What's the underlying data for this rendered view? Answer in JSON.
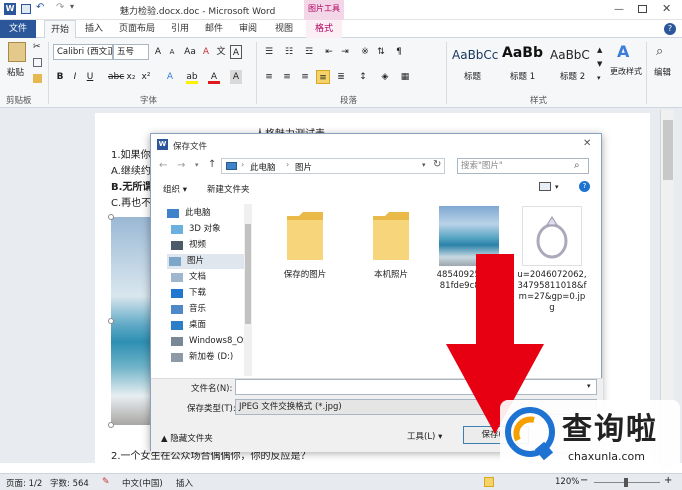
{
  "window": {
    "title": "魅力检验.docx.doc - Microsoft Word",
    "context_tab_group": "图片工具"
  },
  "ribbon_tabs": [
    "文件",
    "开始",
    "插入",
    "页面布局",
    "引用",
    "邮件",
    "审阅",
    "视图",
    "格式"
  ],
  "ribbon": {
    "font_name": "Calibri (西文正",
    "font_size": "五号",
    "paste_label": "粘贴",
    "groups": {
      "clipboard": "剪贴板",
      "font": "字体",
      "paragraph": "段落",
      "styles": "样式"
    },
    "styles": [
      {
        "sample": "AaBbCc",
        "name": "标题"
      },
      {
        "sample": "AaBb",
        "name": "标题 1"
      },
      {
        "sample": "AaBbC",
        "name": "标题 2"
      }
    ],
    "change_styles": "更改样式",
    "edit_label": "编辑"
  },
  "document": {
    "heading": "人格魅力测试表",
    "lines": [
      "1.如果你",
      "A.继续约",
      "B.无所谓",
      "C.再也不"
    ],
    "bottom_line": "2.一个女生在公众场合偶偶你，你的反应是？"
  },
  "dialog": {
    "title": "保存文件",
    "path": [
      "此电脑",
      "图片"
    ],
    "search_placeholder": "搜索\"图片\"",
    "organize": "组织",
    "new_folder": "新建文件夹",
    "sidebar": [
      "此电脑",
      "3D 对象",
      "视频",
      "图片",
      "文档",
      "下载",
      "音乐",
      "桌面",
      "Windows8_OS",
      "新加卷 (D:)"
    ],
    "sidebar_selected_index": 3,
    "files": [
      {
        "name": "保存的图片",
        "kind": "folder"
      },
      {
        "name": "本机照片",
        "kind": "folder"
      },
      {
        "name": "4854092564e081fde9c820bj",
        "kind": "photo"
      },
      {
        "name": "u=2046072062,34795811018&fm=27&gp=0.jpg",
        "kind": "ring"
      }
    ],
    "filename_label": "文件名(N):",
    "filename_value": "",
    "filetype_label": "保存类型(T):",
    "filetype_value": "JPEG 文件交换格式 (*.jpg)",
    "hide_folders": "隐藏文件夹",
    "tools": "工具(L)",
    "save": "保存(S)"
  },
  "status": {
    "page": "页面: 1/2",
    "words": "字数: 564",
    "language": "中文(中国)",
    "mode": "插入",
    "zoom": "120%"
  },
  "watermark": {
    "cn": "查询啦",
    "en": "chaxunla.com"
  },
  "colors": {
    "file_tab": "#2b579a",
    "picture_tools": "#c0006e",
    "arrow": "#e60012",
    "accent_blue": "#1e73d2"
  }
}
